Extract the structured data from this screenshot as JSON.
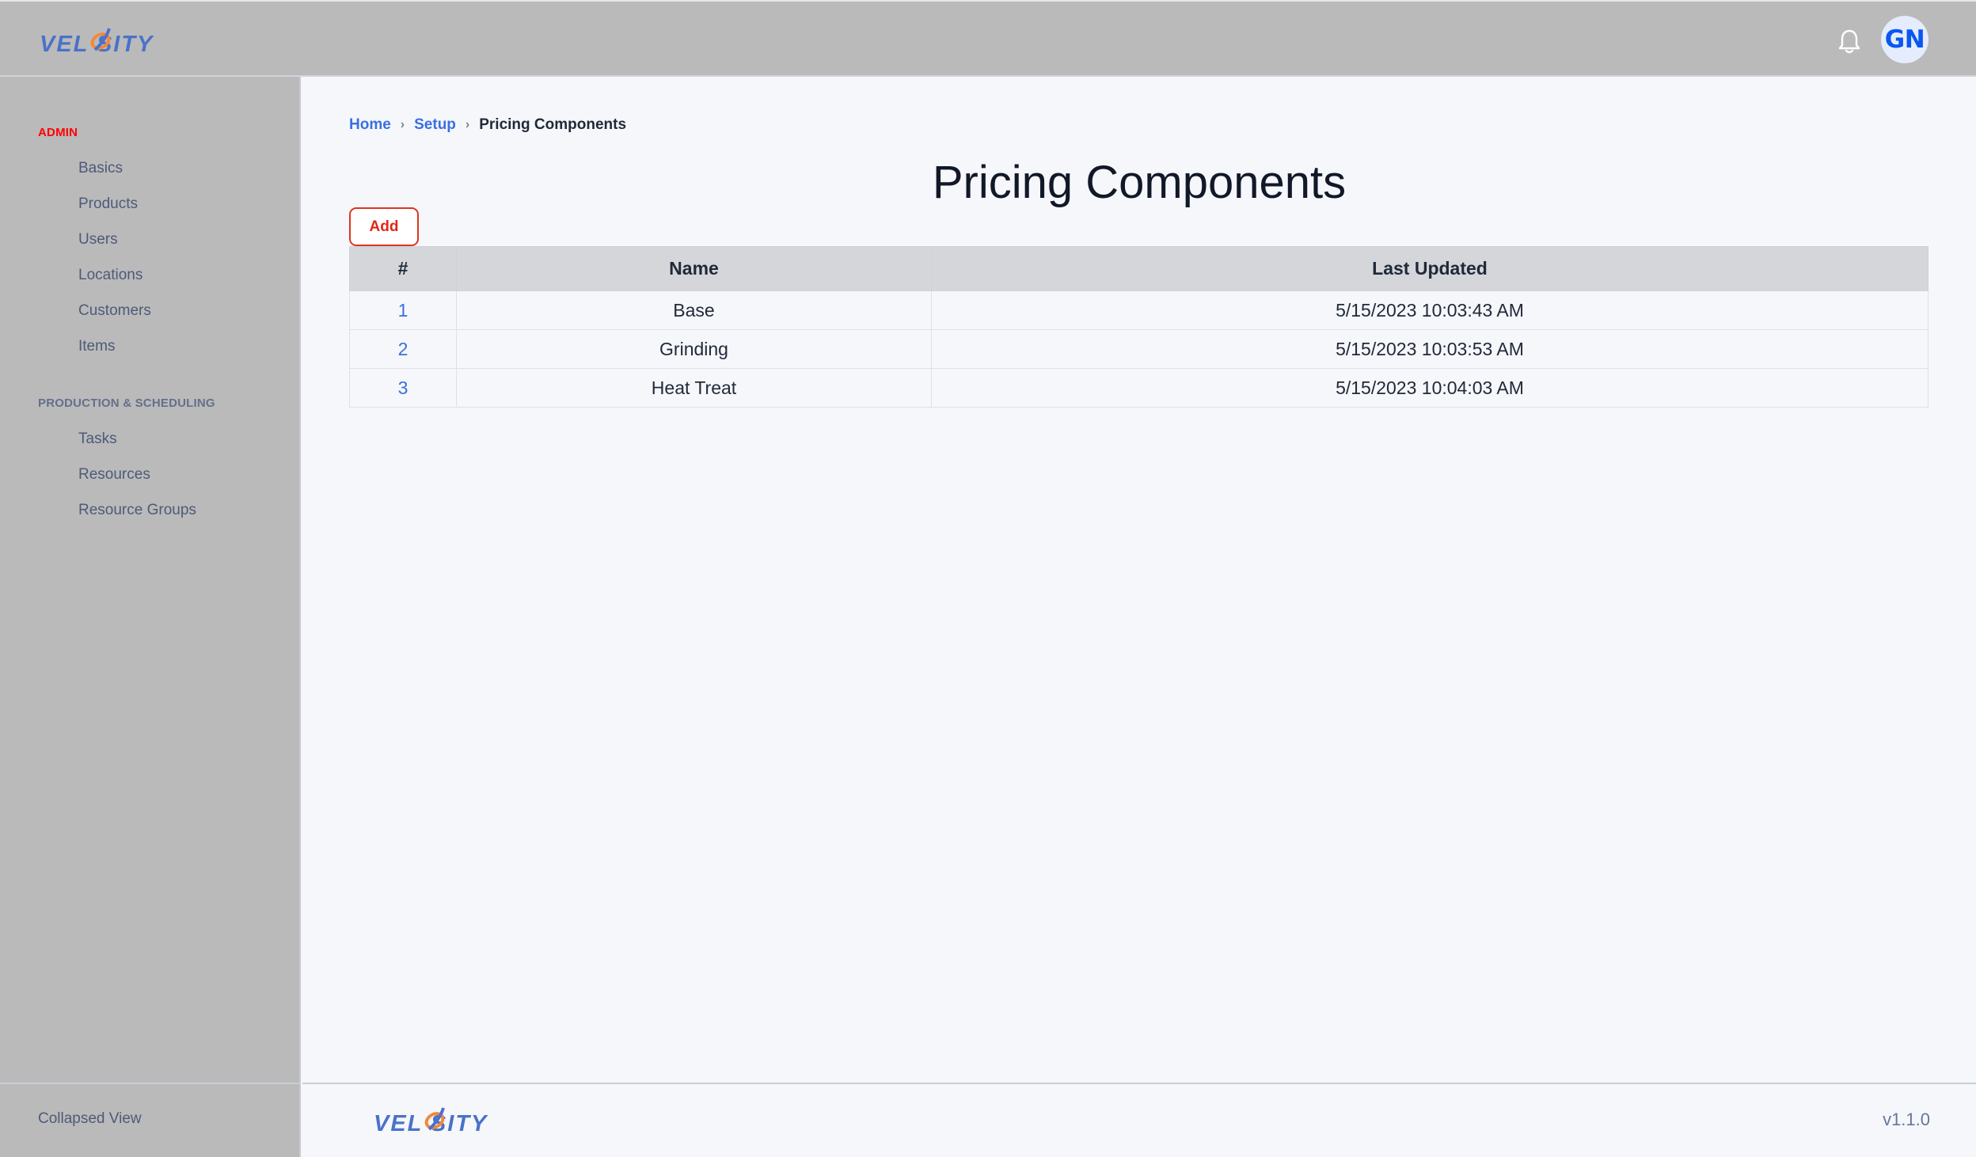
{
  "header": {
    "logo_text": "VELOSITY",
    "avatar_initials": "GN",
    "icons": {
      "notifications": "bell-icon"
    }
  },
  "sidebar": {
    "sections": [
      {
        "label": "ADMIN",
        "items": [
          {
            "label": "Basics"
          },
          {
            "label": "Products"
          },
          {
            "label": "Users"
          },
          {
            "label": "Locations"
          },
          {
            "label": "Customers"
          },
          {
            "label": "Items"
          }
        ]
      },
      {
        "label": "PRODUCTION & SCHEDULING",
        "items": [
          {
            "label": "Tasks"
          },
          {
            "label": "Resources"
          },
          {
            "label": "Resource Groups"
          }
        ]
      }
    ],
    "footer_label": "Collapsed View"
  },
  "breadcrumb": {
    "items": [
      {
        "label": "Home"
      },
      {
        "label": "Setup"
      },
      {
        "label": "Pricing Components"
      }
    ],
    "separator_icon": "chevron-right-icon"
  },
  "page": {
    "title": "Pricing Components",
    "add_label": "Add"
  },
  "table": {
    "columns": [
      "#",
      "Name",
      "Last Updated"
    ],
    "rows": [
      {
        "num": "1",
        "name": "Base",
        "last_updated": "5/15/2023 10:03:43 AM"
      },
      {
        "num": "2",
        "name": "Grinding",
        "last_updated": "5/15/2023 10:03:53 AM"
      },
      {
        "num": "3",
        "name": "Heat Treat",
        "last_updated": "5/15/2023 10:04:03 AM"
      }
    ]
  },
  "footer": {
    "logo_text": "VELOSITY",
    "version": "v1.1.0"
  },
  "colors": {
    "brand_blue": "#3f6fd1",
    "brand_orange": "#f08a3a",
    "accent_red": "#e0251a",
    "link_blue": "#3b6fe0",
    "sidebar_bg": "#bababa",
    "avatar_bg": "#e4ecfd",
    "avatar_text": "#0a56f0"
  }
}
